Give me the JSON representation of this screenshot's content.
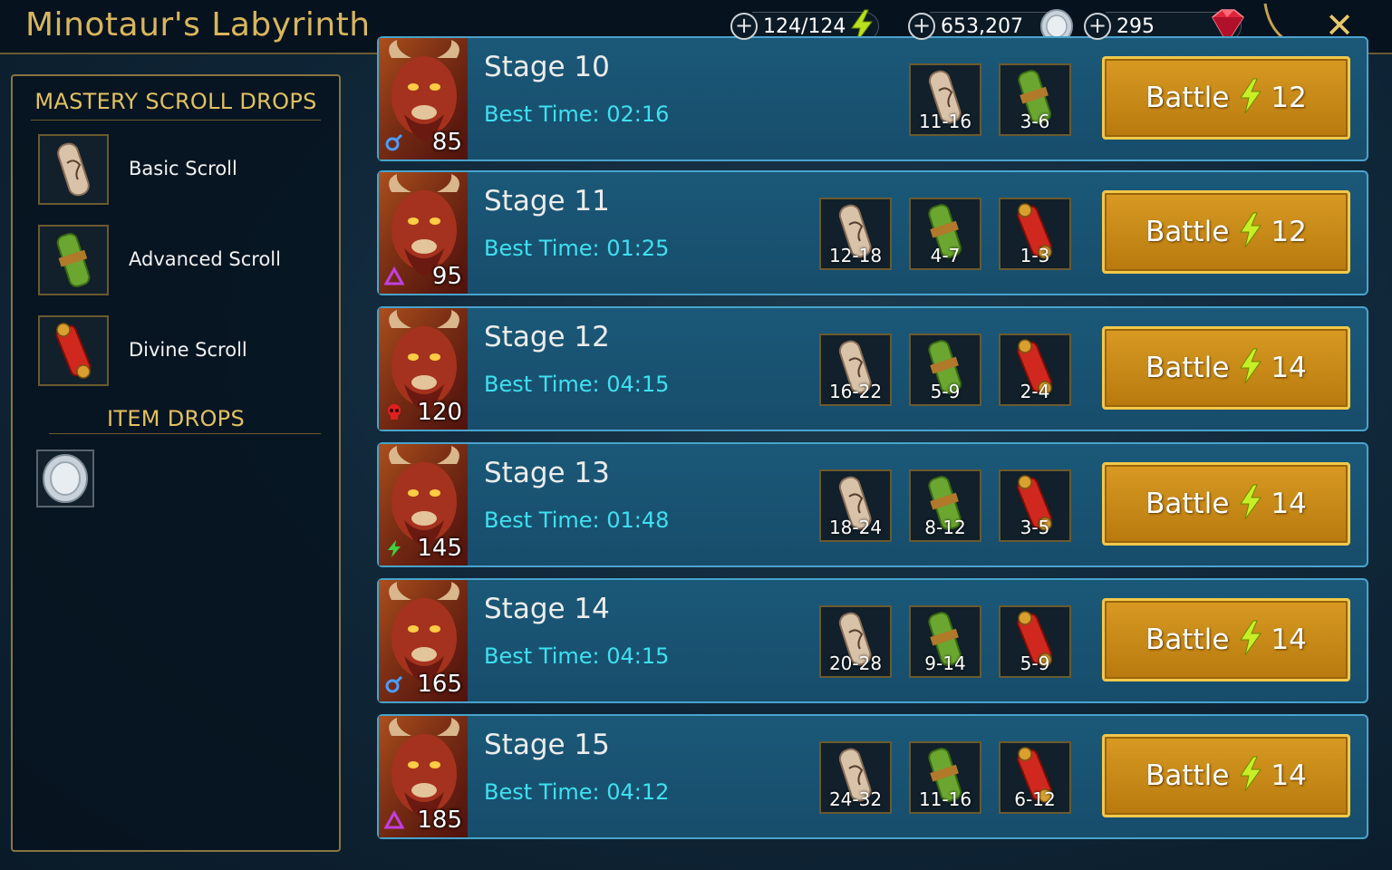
{
  "header": {
    "title": "Minotaur's Labyrinth",
    "energy": "124/124",
    "silver": "653,207",
    "gems": "295"
  },
  "colors": {
    "accent_gold": "#d9b65c",
    "best_time": "#3fe0f0",
    "row_bg": "#1b5878",
    "button_gold": "#d89a22"
  },
  "left_panel": {
    "mastery_heading": "MASTERY SCROLL DROPS",
    "scrolls": [
      {
        "label": "Basic Scroll",
        "icon": "basic-scroll-icon"
      },
      {
        "label": "Advanced Scroll",
        "icon": "advanced-scroll-icon"
      },
      {
        "label": "Divine Scroll",
        "icon": "divine-scroll-icon"
      }
    ],
    "item_heading": "ITEM DROPS",
    "item_icon": "silver-coin-icon"
  },
  "stages": [
    {
      "title": "Stage 10",
      "best": "Best Time: 02:16",
      "level": "85",
      "affinity": "magic",
      "drops": [
        "11-16",
        "3-6"
      ],
      "battle": "Battle",
      "cost": "12"
    },
    {
      "title": "Stage 11",
      "best": "Best Time: 01:25",
      "level": "95",
      "affinity": "spirit",
      "drops": [
        "12-18",
        "4-7",
        "1-3"
      ],
      "battle": "Battle",
      "cost": "12"
    },
    {
      "title": "Stage 12",
      "best": "Best Time: 04:15",
      "level": "120",
      "affinity": "force",
      "drops": [
        "16-22",
        "5-9",
        "2-4"
      ],
      "battle": "Battle",
      "cost": "14"
    },
    {
      "title": "Stage 13",
      "best": "Best Time: 01:48",
      "level": "145",
      "affinity": "void",
      "drops": [
        "18-24",
        "8-12",
        "3-5"
      ],
      "battle": "Battle",
      "cost": "14"
    },
    {
      "title": "Stage 14",
      "best": "Best Time: 04:15",
      "level": "165",
      "affinity": "magic",
      "drops": [
        "20-28",
        "9-14",
        "5-9"
      ],
      "battle": "Battle",
      "cost": "14"
    },
    {
      "title": "Stage 15",
      "best": "Best Time: 04:12",
      "level": "185",
      "affinity": "spirit",
      "drops": [
        "24-32",
        "11-16",
        "6-12"
      ],
      "battle": "Battle",
      "cost": "14"
    }
  ]
}
